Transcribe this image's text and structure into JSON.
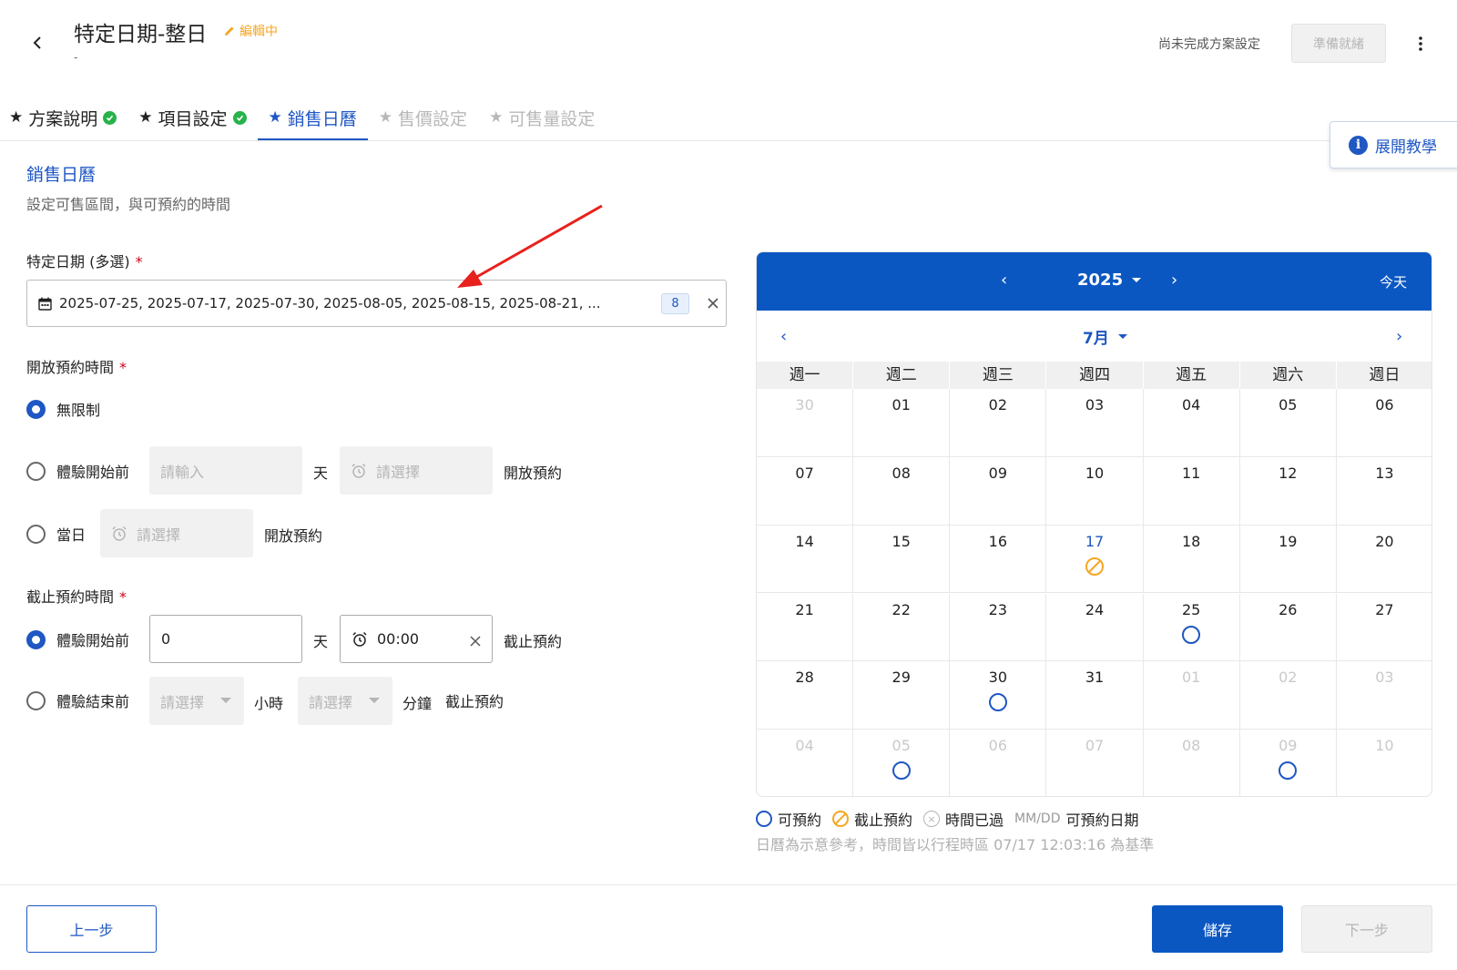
{
  "header": {
    "title": "特定日期-整日",
    "editing_label": "編輯中",
    "subtitle": "-",
    "status_text": "尚未完成方案設定",
    "ready_label": "準備就緒"
  },
  "tabs": [
    {
      "label": "方案說明",
      "state": "done"
    },
    {
      "label": "項目設定",
      "state": "done"
    },
    {
      "label": "銷售日曆",
      "state": "active"
    },
    {
      "label": "售價設定",
      "state": "disabled"
    },
    {
      "label": "可售量設定",
      "state": "disabled"
    }
  ],
  "tutorial_label": "展開教學",
  "section": {
    "title": "銷售日曆",
    "description": "設定可售區間，與可預約的時間"
  },
  "dates_field": {
    "label": "特定日期 (多選)",
    "value": "2025-07-25, 2025-07-17, 2025-07-30, 2025-08-05, 2025-08-15, 2025-08-21, ...",
    "count": "8"
  },
  "open_time": {
    "label": "開放預約時間",
    "options": {
      "unlimited": "無限制",
      "before_start": "體驗開始前",
      "same_day": "當日"
    },
    "days_placeholder": "請輸入",
    "time_placeholder": "請選擇",
    "unit_day": "天",
    "open_suffix": "開放預約"
  },
  "close_time": {
    "label": "截止預約時間",
    "options": {
      "before_start": "體驗開始前",
      "before_end": "體驗結束前"
    },
    "days_value": "0",
    "time_value": "00:00",
    "unit_day": "天",
    "unit_hour": "小時",
    "unit_minute": "分鐘",
    "select_placeholder": "請選擇",
    "close_suffix": "截止預約"
  },
  "calendar": {
    "year": "2025",
    "month": "7月",
    "today_label": "今天",
    "weekdays": [
      "週一",
      "週二",
      "週三",
      "週四",
      "週五",
      "週六",
      "週日"
    ],
    "days": [
      {
        "d": "30",
        "out": true
      },
      {
        "d": "01"
      },
      {
        "d": "02"
      },
      {
        "d": "03"
      },
      {
        "d": "04"
      },
      {
        "d": "05"
      },
      {
        "d": "06"
      },
      {
        "d": "07"
      },
      {
        "d": "08"
      },
      {
        "d": "09"
      },
      {
        "d": "10"
      },
      {
        "d": "11"
      },
      {
        "d": "12"
      },
      {
        "d": "13"
      },
      {
        "d": "14"
      },
      {
        "d": "15"
      },
      {
        "d": "16"
      },
      {
        "d": "17",
        "hl": true,
        "mark": "cut"
      },
      {
        "d": "18"
      },
      {
        "d": "19"
      },
      {
        "d": "20"
      },
      {
        "d": "21"
      },
      {
        "d": "22"
      },
      {
        "d": "23"
      },
      {
        "d": "24"
      },
      {
        "d": "25",
        "mark": "ok"
      },
      {
        "d": "26"
      },
      {
        "d": "27"
      },
      {
        "d": "28"
      },
      {
        "d": "29"
      },
      {
        "d": "30",
        "mark": "ok"
      },
      {
        "d": "31"
      },
      {
        "d": "01",
        "out": true
      },
      {
        "d": "02",
        "out": true
      },
      {
        "d": "03",
        "out": true
      },
      {
        "d": "04",
        "out": true
      },
      {
        "d": "05",
        "out": true,
        "mark": "ok"
      },
      {
        "d": "06",
        "out": true
      },
      {
        "d": "07",
        "out": true
      },
      {
        "d": "08",
        "out": true
      },
      {
        "d": "09",
        "out": true,
        "mark": "ok"
      },
      {
        "d": "10",
        "out": true
      }
    ]
  },
  "legend": {
    "available": "可預約",
    "cutoff": "截止預約",
    "past": "時間已過",
    "mmdd": "MM/DD",
    "mmdd_desc": "可預約日期"
  },
  "note": "日曆為示意參考，時間皆以行程時區 07/17 12:03:16 為基準",
  "footer": {
    "prev_label": "上一步",
    "save_label": "儲存",
    "next_label": "下一步"
  },
  "colors": {
    "primary": "#0b57c2",
    "accent_orange": "#f5a623",
    "success": "#27b24a",
    "annotation_red": "#e8211c"
  }
}
